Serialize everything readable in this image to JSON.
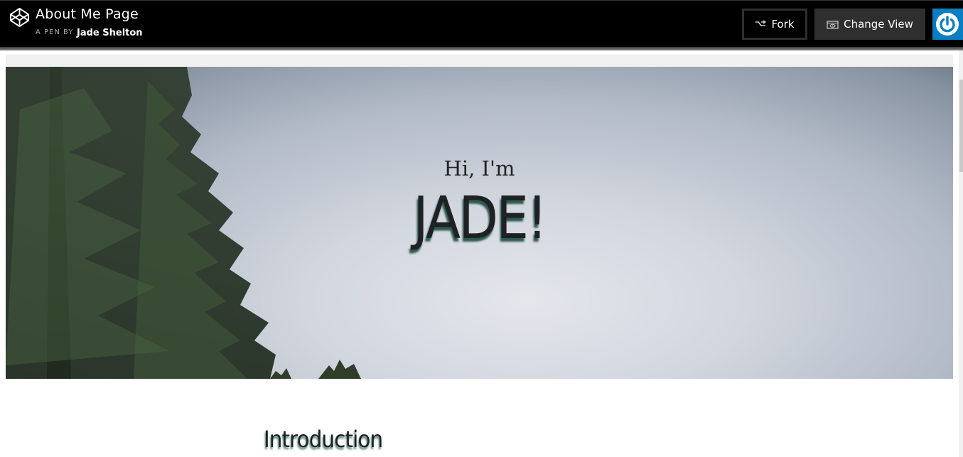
{
  "header": {
    "title": "About Me Page",
    "byline": "A PEN BY",
    "author": "Jade Shelton",
    "logo_icon": "codepen-logo-icon",
    "fork_label": "Fork",
    "fork_icon": "fork-icon",
    "change_view_label": "Change View",
    "change_view_icon": "eye-icon",
    "power_icon": "power-icon",
    "power_color": "#0a7ec2"
  },
  "hero": {
    "greeting": "Hi, I'm",
    "name": "JADE!"
  },
  "sections": {
    "intro_heading": "Introduction"
  }
}
